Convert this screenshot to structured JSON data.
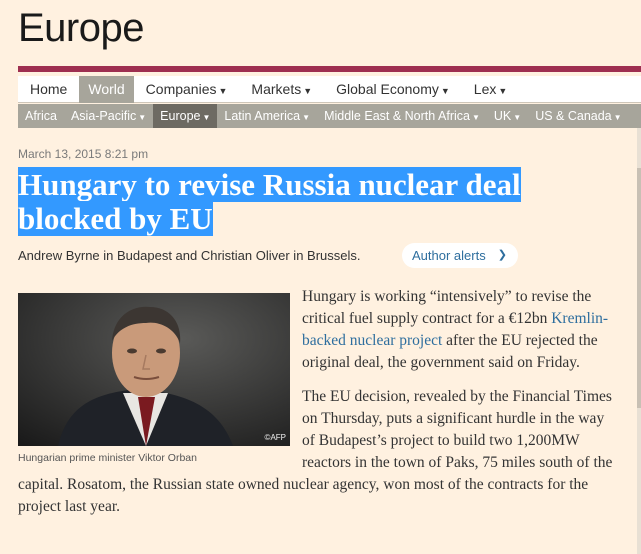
{
  "section": {
    "title": "Europe"
  },
  "nav": {
    "primary": [
      {
        "label": "Home",
        "chevron": false,
        "active": false
      },
      {
        "label": "World",
        "chevron": false,
        "active": true
      },
      {
        "label": "Companies",
        "chevron": true,
        "active": false
      },
      {
        "label": "Markets",
        "chevron": true,
        "active": false
      },
      {
        "label": "Global Economy",
        "chevron": true,
        "active": false
      },
      {
        "label": "Lex",
        "chevron": true,
        "active": false
      }
    ],
    "secondary": [
      {
        "label": "Africa",
        "chevron": false,
        "active": false
      },
      {
        "label": "Asia-Pacific",
        "chevron": true,
        "active": false
      },
      {
        "label": "Europe",
        "chevron": true,
        "active": true
      },
      {
        "label": "Latin America",
        "chevron": true,
        "active": false
      },
      {
        "label": "Middle East & North Africa",
        "chevron": true,
        "active": false
      },
      {
        "label": "UK",
        "chevron": true,
        "active": false
      },
      {
        "label": "US & Canada",
        "chevron": true,
        "active": false
      }
    ]
  },
  "article": {
    "date": "March 13, 2015 8:21 pm",
    "headline_line1": "Hungary to revise Russia nuclear deal",
    "headline_line2": "blocked by EU",
    "byline": "Andrew Byrne in Budapest and Christian Oliver in Brussels.",
    "author_alerts": "Author alerts",
    "image": {
      "credit": "©AFP",
      "caption": "Hungarian prime minister Viktor Orban"
    },
    "p1_before": "Hungary is working “intensively” to revise the critical fuel supply contract for a €12bn ",
    "p1_link": "Kremlin-backed nuclear project",
    "p1_after": " after the EU rejected the original deal, the government said on Friday.",
    "p2": "The EU decision, revealed by the Financial Times on Thursday, puts a significant hurdle in the way of Budapest’s project to build two 1,200MW reactors in the town of Paks, 75 miles south of the capital. Rosatom, the Russian state owned nuclear agency, won most of the contracts for the project last year."
  },
  "colors": {
    "page_bg": "#fff1e0",
    "accent_rule": "#9e2f50",
    "nav_active": "#a7a59b",
    "subnav_bg": "#a7a59b",
    "subnav_active": "#6d6a62",
    "selection": "#3399ff",
    "link": "#2e6e9e"
  }
}
